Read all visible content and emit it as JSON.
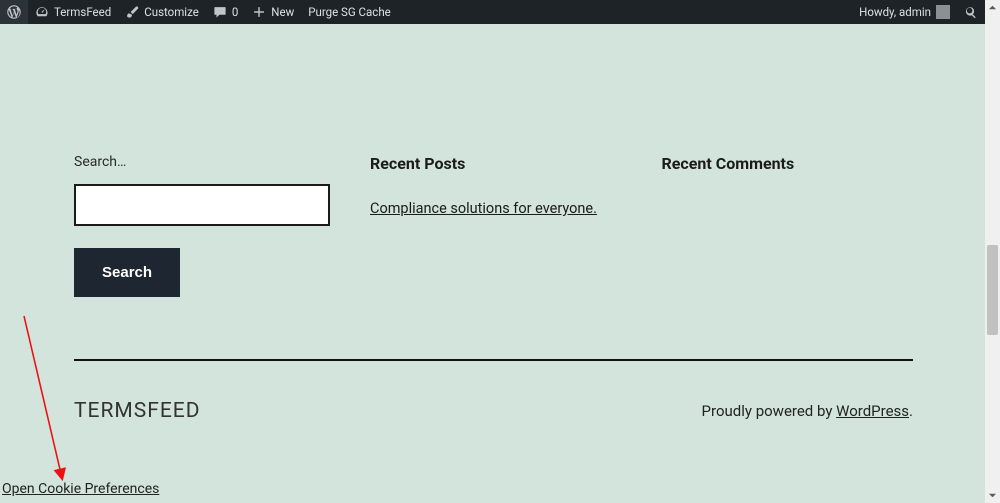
{
  "adminbar": {
    "site_name": "TermsFeed",
    "customize": "Customize",
    "comments_count": "0",
    "new": "New",
    "purge": "Purge SG Cache",
    "howdy": "Howdy, admin"
  },
  "widgets": {
    "search": {
      "label": "Search…",
      "button": "Search",
      "value": ""
    },
    "recent_posts": {
      "heading": "Recent Posts",
      "items": [
        "Compliance solutions for everyone."
      ]
    },
    "recent_comments": {
      "heading": "Recent Comments"
    }
  },
  "footer": {
    "brand": "TERMSFEED",
    "powered_prefix": "Proudly powered by ",
    "powered_link": "WordPress",
    "powered_suffix": "."
  },
  "cookie_link": "Open Cookie Preferences"
}
